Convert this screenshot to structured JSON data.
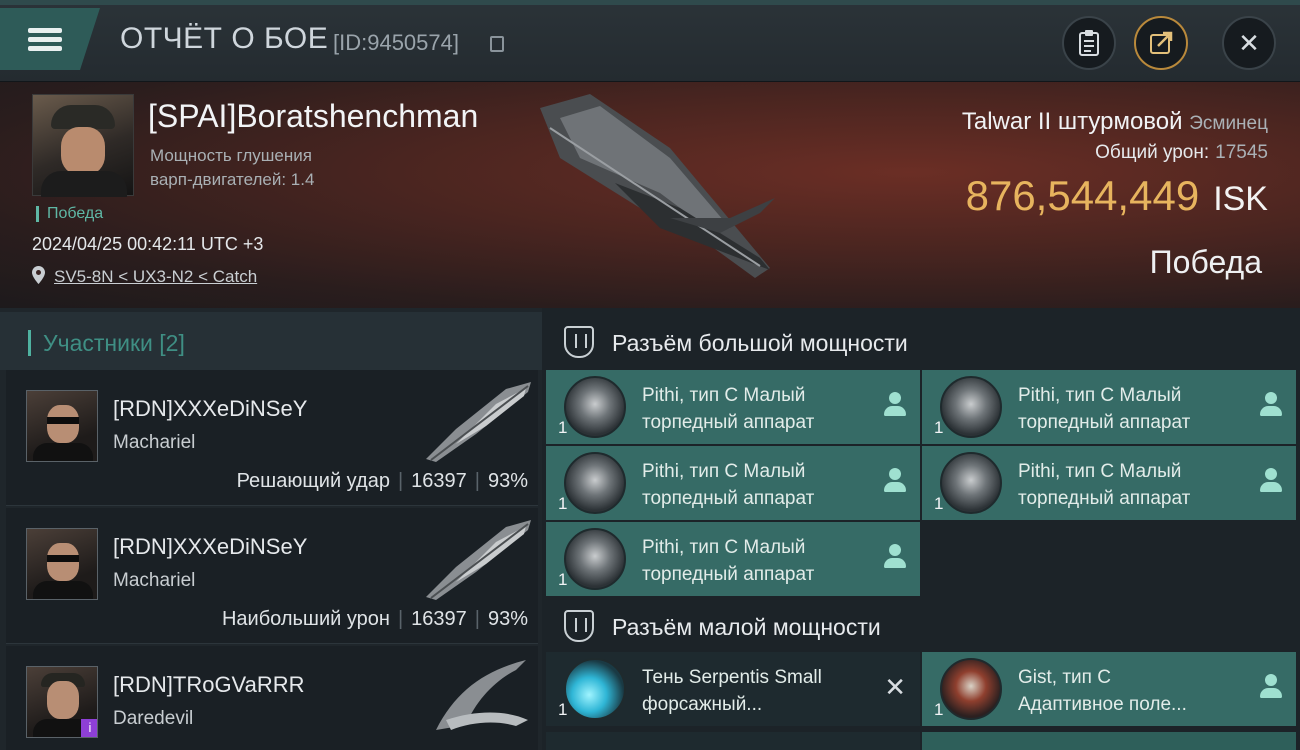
{
  "topbar": {
    "title": "ОТЧЁТ О БОЕ",
    "report_id": "[ID:9450574]"
  },
  "pilot": {
    "name": "[SPAI]Boratshenchman",
    "attribute_line1": "Мощность глушения",
    "attribute_line2": "варп-двигателей: 1.4",
    "status": "Победа",
    "datetime": "2024/04/25 00:42:11 UTC +3",
    "location": "SV5-8N < UX3-N2 < Catch"
  },
  "summary": {
    "ship_name": "Talwar II штурмовой",
    "ship_class": "Эсминец",
    "total_damage_label": "Общий урон:",
    "total_damage": "17545",
    "isk_value": "876,544,449",
    "isk_unit": "ISK",
    "result": "Победа"
  },
  "participants": {
    "title": "Участники [2]",
    "rows": [
      {
        "name": "[RDN]XXXeDiNSeY",
        "ship": "Machariel",
        "label": "Решающий удар",
        "damage": "16397",
        "percent": "93%"
      },
      {
        "name": "[RDN]XXXeDiNSeY",
        "ship": "Machariel",
        "label": "Наибольший урон",
        "damage": "16397",
        "percent": "93%"
      },
      {
        "name": "[RDN]TRoGVaRRR",
        "ship": "Daredevil",
        "badge": "i"
      }
    ]
  },
  "fitting": {
    "high_title": "Разъём большой мощности",
    "low_title": "Разъём малой мощности",
    "high_slots": [
      {
        "line1": "Pithi, тип C Малый",
        "line2": "торпедный аппарат",
        "qty": "1"
      },
      {
        "line1": "Pithi, тип C Малый",
        "line2": "торпедный аппарат",
        "qty": "1"
      },
      {
        "line1": "Pithi, тип C Малый",
        "line2": "торпедный аппарат",
        "qty": "1"
      },
      {
        "line1": "Pithi, тип C Малый",
        "line2": "торпедный аппарат",
        "qty": "1"
      },
      {
        "line1": "Pithi, тип C Малый",
        "line2": "торпедный аппарат",
        "qty": "1"
      }
    ],
    "low_slots": [
      {
        "line1": "Тень Serpentis Small",
        "line2": "форсажный...",
        "qty": "1"
      },
      {
        "line1": "Gist, тип C",
        "line2": "Адаптивное поле...",
        "qty": "1"
      }
    ]
  },
  "colors": {
    "accent_teal": "#366b66",
    "isk_gold": "#e7b45e",
    "victory_green": "#5fb7a5"
  }
}
